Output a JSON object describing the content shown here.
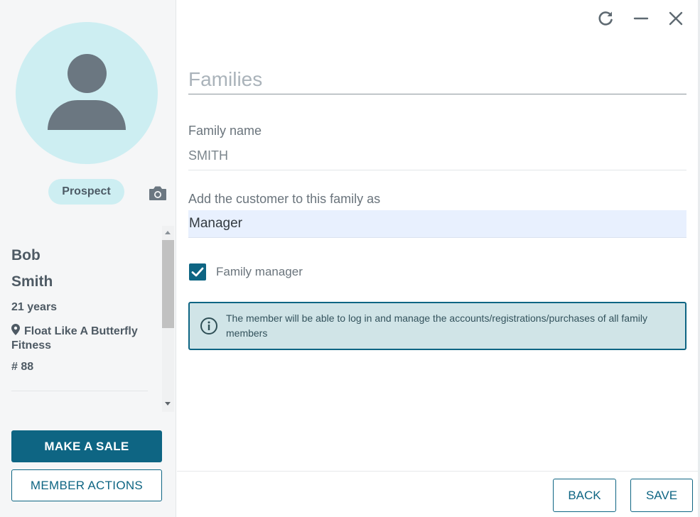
{
  "window_controls": {
    "refresh_icon": "refresh-icon",
    "minimize_icon": "minimize-icon",
    "close_icon": "close-icon"
  },
  "profile": {
    "status": "Prospect",
    "first_name": "Bob",
    "last_name": "Smith",
    "age": "21 years",
    "location": "Float Like A Butterfly Fitness",
    "member_number": "# 88"
  },
  "actions": {
    "make_sale": "MAKE A SALE",
    "member_actions": "MEMBER ACTIONS"
  },
  "form": {
    "section_title": "Families",
    "family_name_label": "Family name",
    "family_name_value": "SMITH",
    "role_label": "Add the customer to this family as",
    "role_value": "Manager",
    "family_manager_label": "Family manager",
    "family_manager_checked": true,
    "info_text": "The member will be able to log in and manage the accounts/registrations/purchases of all family members"
  },
  "footer": {
    "back": "BACK",
    "save": "SAVE"
  },
  "colors": {
    "accent": "#0e6583",
    "avatar_bg": "#cdeef2",
    "info_bg": "#d0e4e7",
    "select_bg": "#e8f0fe"
  }
}
